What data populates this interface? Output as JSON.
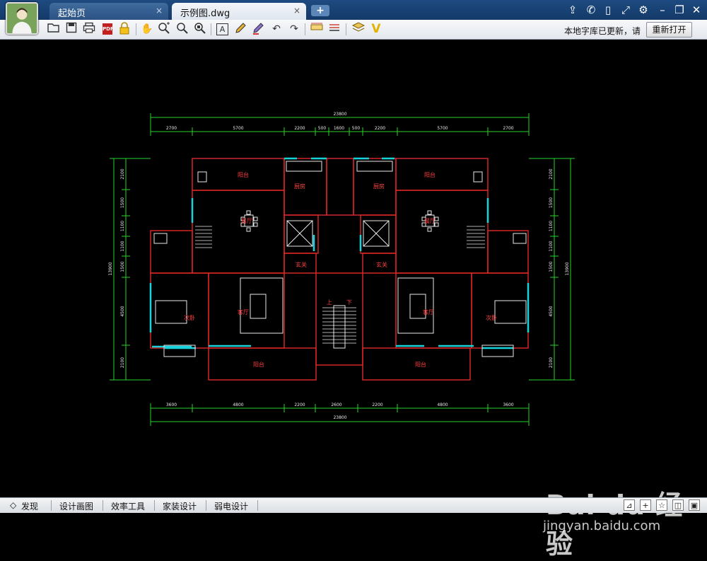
{
  "titlebar": {
    "tabs": [
      {
        "label": "起始页",
        "close": "×"
      },
      {
        "label": "示例图.dwg",
        "close": "×"
      }
    ],
    "new_tab": "+",
    "controls": [
      "share-icon",
      "wechat-icon",
      "mobile-icon",
      "fullscreen-icon",
      "settings-icon",
      "minimize-icon",
      "restore-icon",
      "close-icon"
    ]
  },
  "toolbar": {
    "tools": [
      "open-icon",
      "save-icon",
      "print-icon",
      "pdf-icon",
      "lock-icon",
      "pan-icon",
      "zoom-in-icon",
      "zoom-window-icon",
      "zoom-extent-icon",
      "text-icon",
      "pencil-icon",
      "highlighter-icon",
      "undo-icon",
      "redo-icon",
      "measure-icon",
      "dimension-icon",
      "layers-icon",
      "check-icon"
    ],
    "pdf_text": "PDF",
    "text_tool": "A",
    "notice": "本地字库已更新，请",
    "reopen_button": "重新打开"
  },
  "drawing": {
    "top_dims": [
      "2700",
      "5700",
      "2200",
      "500",
      "1600",
      "500",
      "2200",
      "5700",
      "2700"
    ],
    "top_total": "23800",
    "bottom_dims": [
      "3600",
      "4800",
      "2200",
      "2600",
      "2200",
      "4800",
      "3600"
    ],
    "bottom_total": "23800",
    "left_dims": [
      "2100",
      "1500",
      "1100",
      "1100",
      "1500",
      "4500",
      "2100"
    ],
    "left_total": "13900",
    "right_dims": [
      "2100",
      "1500",
      "1100",
      "1100",
      "1500",
      "4500",
      "2100"
    ],
    "right_total": "13900",
    "rooms": {
      "balcony": "阳台",
      "kitchen": "厨房",
      "dining": "餐厅",
      "entrance": "玄关",
      "living": "客厅",
      "bedroom": "次卧",
      "stair_up": "上",
      "stair_down": "下"
    }
  },
  "watermark": {
    "brand": "Bai du 经验",
    "url": "jingyan.baidu.com"
  },
  "bottombar": {
    "tabs": [
      "发现",
      "设计画图",
      "效率工具",
      "家装设计",
      "弱电设计"
    ],
    "discover_icon": "◇",
    "icons": [
      "layout-icon",
      "crosshair-icon",
      "star-icon",
      "layers-icon",
      "window-icon"
    ]
  },
  "colors": {
    "canvas": "#000000",
    "dim_line": "#27d427",
    "wall": "#e02828",
    "window": "#19d3dc",
    "furniture": "#e8e8e8",
    "titlebar": "#1d4a80"
  }
}
